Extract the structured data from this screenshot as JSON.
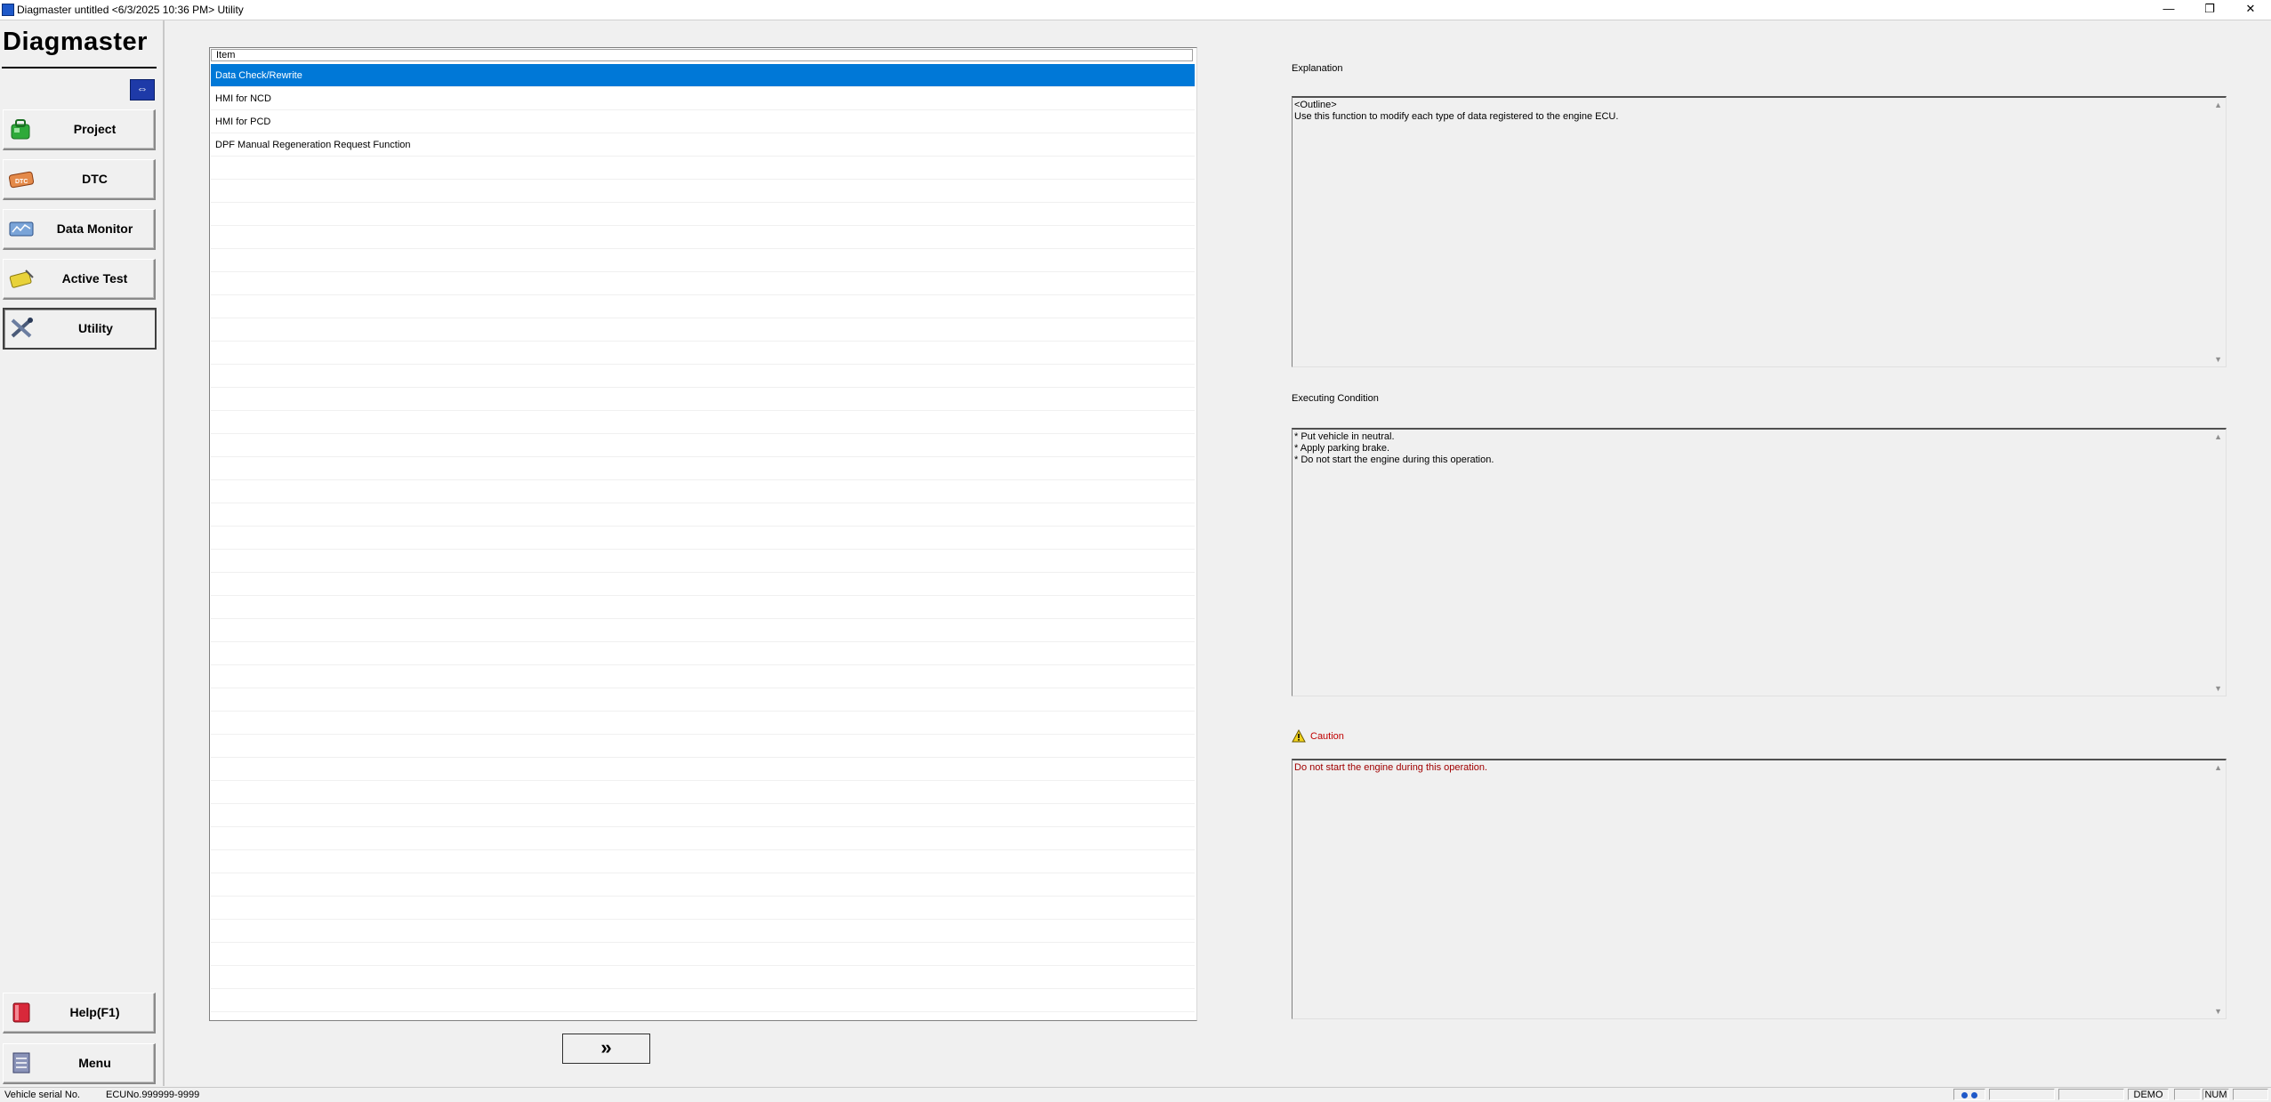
{
  "window": {
    "title": "Diagmaster untitled <6/3/2025 10:36 PM> Utility",
    "minimize_label": "—",
    "restore_label": "❐",
    "close_label": "✕"
  },
  "sidebar": {
    "logo": "Diagmaster",
    "toggle_label": "⇔",
    "items": [
      {
        "label": "Project",
        "icon": "project-icon"
      },
      {
        "label": "DTC",
        "icon": "dtc-icon"
      },
      {
        "label": "Data Monitor",
        "icon": "data-monitor-icon"
      },
      {
        "label": "Active Test",
        "icon": "active-test-icon"
      },
      {
        "label": "Utility",
        "icon": "utility-icon",
        "active": true
      }
    ],
    "help_label": "Help(F1)",
    "menu_label": "Menu"
  },
  "item_list": {
    "header": "Item",
    "rows": [
      "Data Check/Rewrite",
      "HMI for NCD",
      "HMI for PCD",
      "DPF Manual Regeneration Request Function"
    ],
    "selected_index": 0
  },
  "next_button": {
    "label": "»"
  },
  "explanation": {
    "label": "Explanation",
    "text": "<Outline>\nUse this function to modify each type of data registered to the engine ECU."
  },
  "executing_condition": {
    "label": "Executing Condition",
    "text": "* Put vehicle in neutral.\n* Apply parking brake.\n* Do not start the engine during this operation."
  },
  "caution": {
    "label": "Caution",
    "text": "Do not start the engine during this operation.",
    "color": "#c00000"
  },
  "statusbar": {
    "vehicle_serial": "Vehicle serial No.",
    "ecu_no": "ECUNo.999999-9999",
    "demo": "DEMO",
    "num": "NUM"
  },
  "colors": {
    "selection": "#0078d7",
    "background": "#f0f0f0"
  }
}
